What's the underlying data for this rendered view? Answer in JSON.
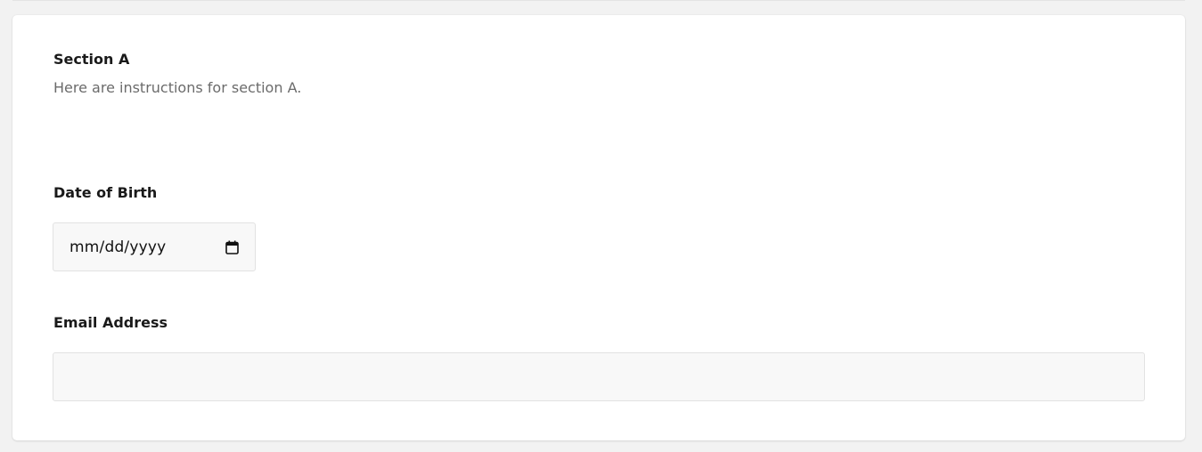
{
  "section": {
    "title": "Section A",
    "instructions": "Here are instructions for section A."
  },
  "fields": {
    "dob": {
      "label": "Date of Birth",
      "placeholder": "mm/dd/yyyy",
      "icon": "calendar-icon"
    },
    "email": {
      "label": "Email Address",
      "value": "",
      "placeholder": ""
    }
  },
  "colors": {
    "page_background": "#f2f2f2",
    "card_background": "#ffffff",
    "input_background": "#f8f8f8",
    "label_text": "#1a1a1a",
    "muted_text": "#6b6b6b"
  }
}
